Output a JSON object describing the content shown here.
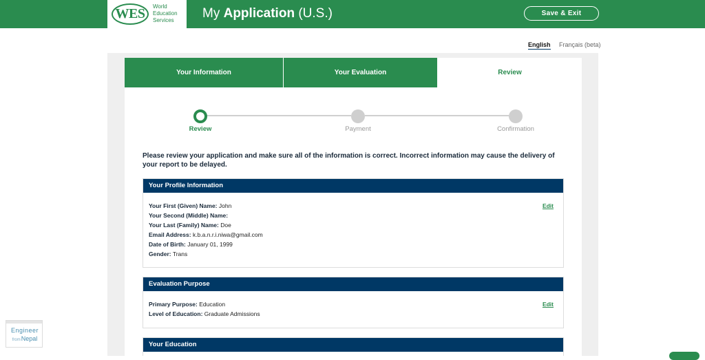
{
  "header": {
    "logo_mark": "WES",
    "logo_line1": "World",
    "logo_line2": "Education",
    "logo_line3": "Services",
    "title_prefix": "My ",
    "title_bold": "Application",
    "title_suffix": " (U.S.)",
    "save_exit_label": "Save & Exit"
  },
  "language": {
    "english": "English",
    "french": "Français (beta)"
  },
  "tabs": [
    {
      "label": "Your Information"
    },
    {
      "label": "Your Evaluation"
    },
    {
      "label": "Review"
    }
  ],
  "steps": [
    {
      "label": "Review"
    },
    {
      "label": "Payment"
    },
    {
      "label": "Confirmation"
    }
  ],
  "instructions": "Please review your application and make sure all of the information is correct. Incorrect information may cause the delivery of your report to be delayed.",
  "profile": {
    "title": "Your Profile Information",
    "edit_label": "Edit",
    "rows": [
      {
        "label": "Your First (Given) Name:",
        "value": "John"
      },
      {
        "label": "Your Second (Middle) Name:",
        "value": ""
      },
      {
        "label": "Your Last (Family) Name:",
        "value": "Doe"
      },
      {
        "label": "Email Address:",
        "value": "k.b.a.n.r.i.niwa@gmail.com"
      },
      {
        "label": "Date of Birth:",
        "value": "January 01, 1999"
      },
      {
        "label": "Gender:",
        "value": "Trans"
      }
    ]
  },
  "purpose": {
    "title": "Evaluation Purpose",
    "edit_label": "Edit",
    "rows": [
      {
        "label": "Primary Purpose:",
        "value": "Education"
      },
      {
        "label": "Level of Education:",
        "value": "Graduate Admissions"
      }
    ]
  },
  "education": {
    "title": "Your Education"
  },
  "watermark": {
    "line1": "Engineer",
    "small": "from",
    "line2": "Nepal"
  },
  "colors": {
    "brand_green": "#2a8c4f",
    "navy": "#003865"
  }
}
